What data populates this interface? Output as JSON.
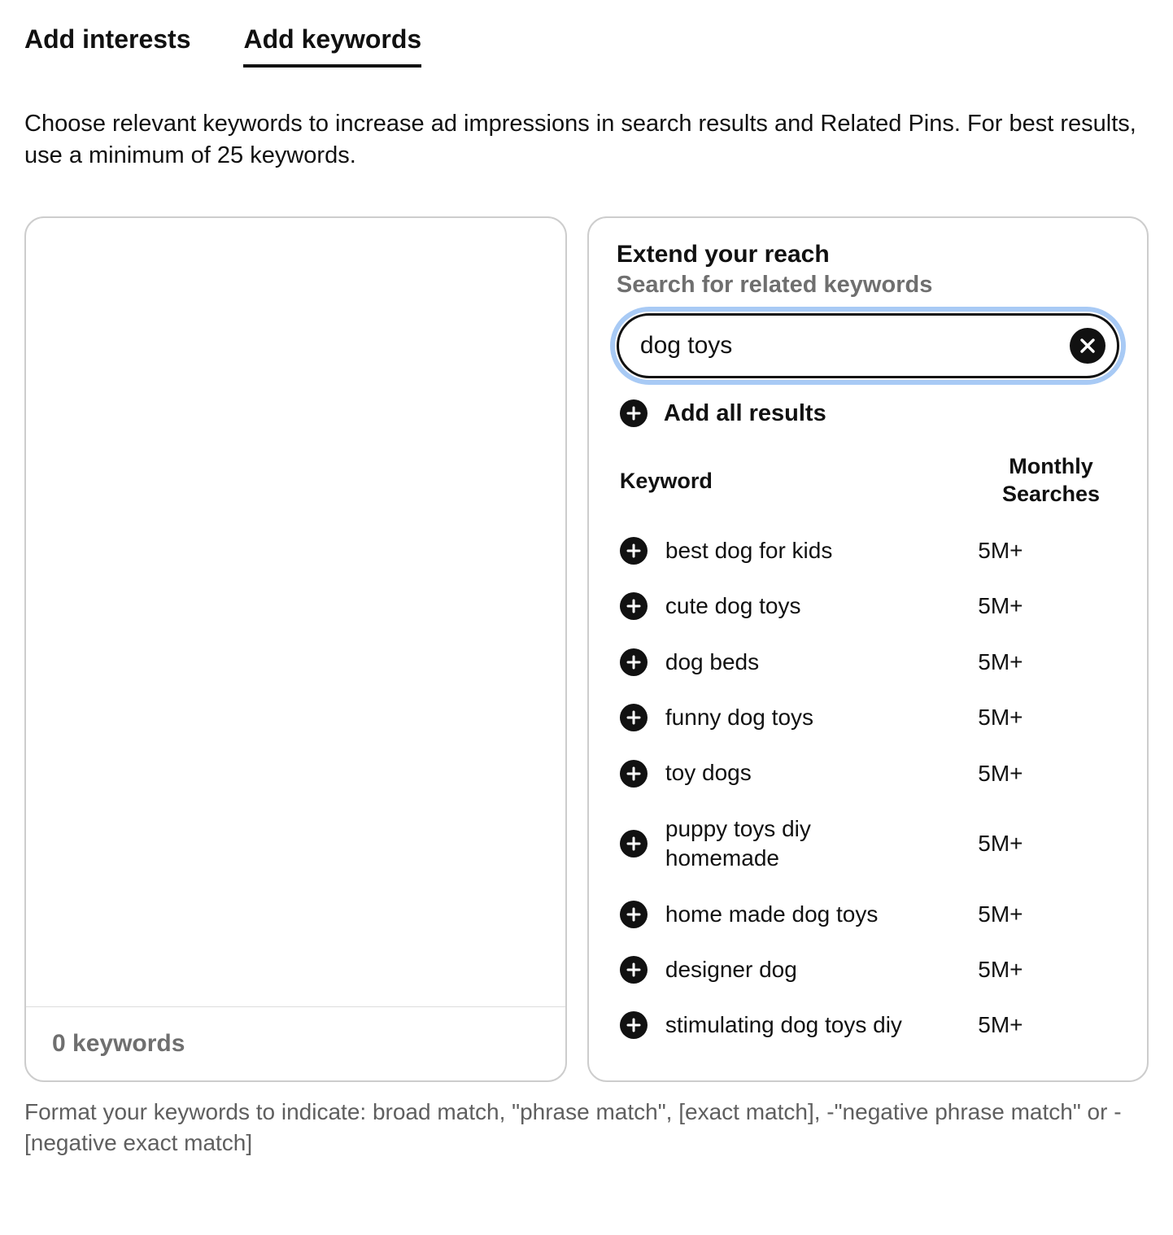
{
  "tabs": {
    "interests": "Add interests",
    "keywords": "Add keywords"
  },
  "description": "Choose relevant keywords to increase ad impressions in search results and Related Pins. For best results, use a minimum of 25 keywords.",
  "left": {
    "count_label": "0 keywords"
  },
  "right": {
    "title": "Extend your reach",
    "subtitle": "Search for related keywords",
    "search_value": "dog toys",
    "add_all": "Add all results",
    "th_keyword": "Keyword",
    "th_searches": "Monthly Searches",
    "results": [
      {
        "keyword": "best dog for kids",
        "searches": "5M+"
      },
      {
        "keyword": "cute dog toys",
        "searches": "5M+"
      },
      {
        "keyword": "dog beds",
        "searches": "5M+"
      },
      {
        "keyword": "funny dog toys",
        "searches": "5M+"
      },
      {
        "keyword": "toy dogs",
        "searches": "5M+"
      },
      {
        "keyword": "puppy toys diy homemade",
        "searches": "5M+"
      },
      {
        "keyword": "home made dog toys",
        "searches": "5M+"
      },
      {
        "keyword": "designer dog",
        "searches": "5M+"
      },
      {
        "keyword": "stimulating dog toys diy",
        "searches": "5M+"
      }
    ]
  },
  "footer_note": "Format your keywords to indicate: broad match, \"phrase match\", [exact match], -\"negative phrase match\" or -[negative exact match]"
}
